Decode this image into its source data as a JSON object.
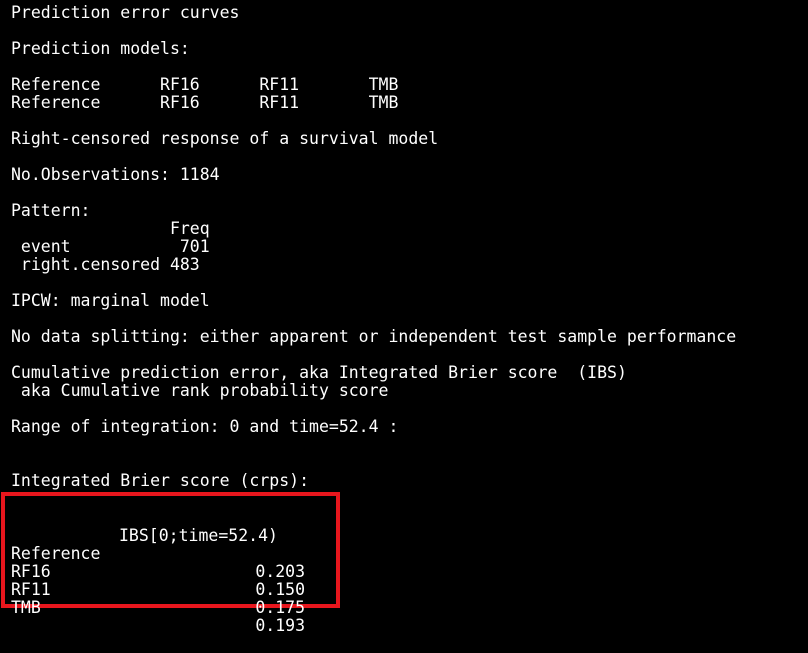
{
  "console": {
    "title": "Prediction error curves",
    "models_heading": "Prediction models:",
    "models_row1": "Reference      RF16      RF11       TMB",
    "models_row2": "Reference      RF16      RF11       TMB",
    "response": "Right-censored response of a survival model",
    "observations": "No.Observations: 1184",
    "pattern_heading": "Pattern:",
    "pattern_freq_header": "                Freq",
    "pattern_event": " event           701",
    "pattern_censored": " right.censored 483",
    "ipcw": "IPCW: marginal model",
    "splitting": "No data splitting: either apparent or independent test sample performance",
    "cumulative_line1": "Cumulative prediction error, aka Integrated Brier score  (IBS)",
    "cumulative_line2": " aka Cumulative rank probability score",
    "range": "Range of integration: 0 and time=52.4 :",
    "ibs_heading": "Integrated Brier score (crps):"
  },
  "ibs_table": {
    "header": "IBS[0;time=52.4)",
    "rows": [
      {
        "model": "Reference",
        "value": "0.203"
      },
      {
        "model": "RF16",
        "value": "0.150"
      },
      {
        "model": "RF11",
        "value": "0.175"
      },
      {
        "model": "TMB",
        "value": "0.193"
      }
    ]
  },
  "colors": {
    "background": "#000000",
    "text": "#ffffff",
    "highlight": "#e8161d"
  }
}
